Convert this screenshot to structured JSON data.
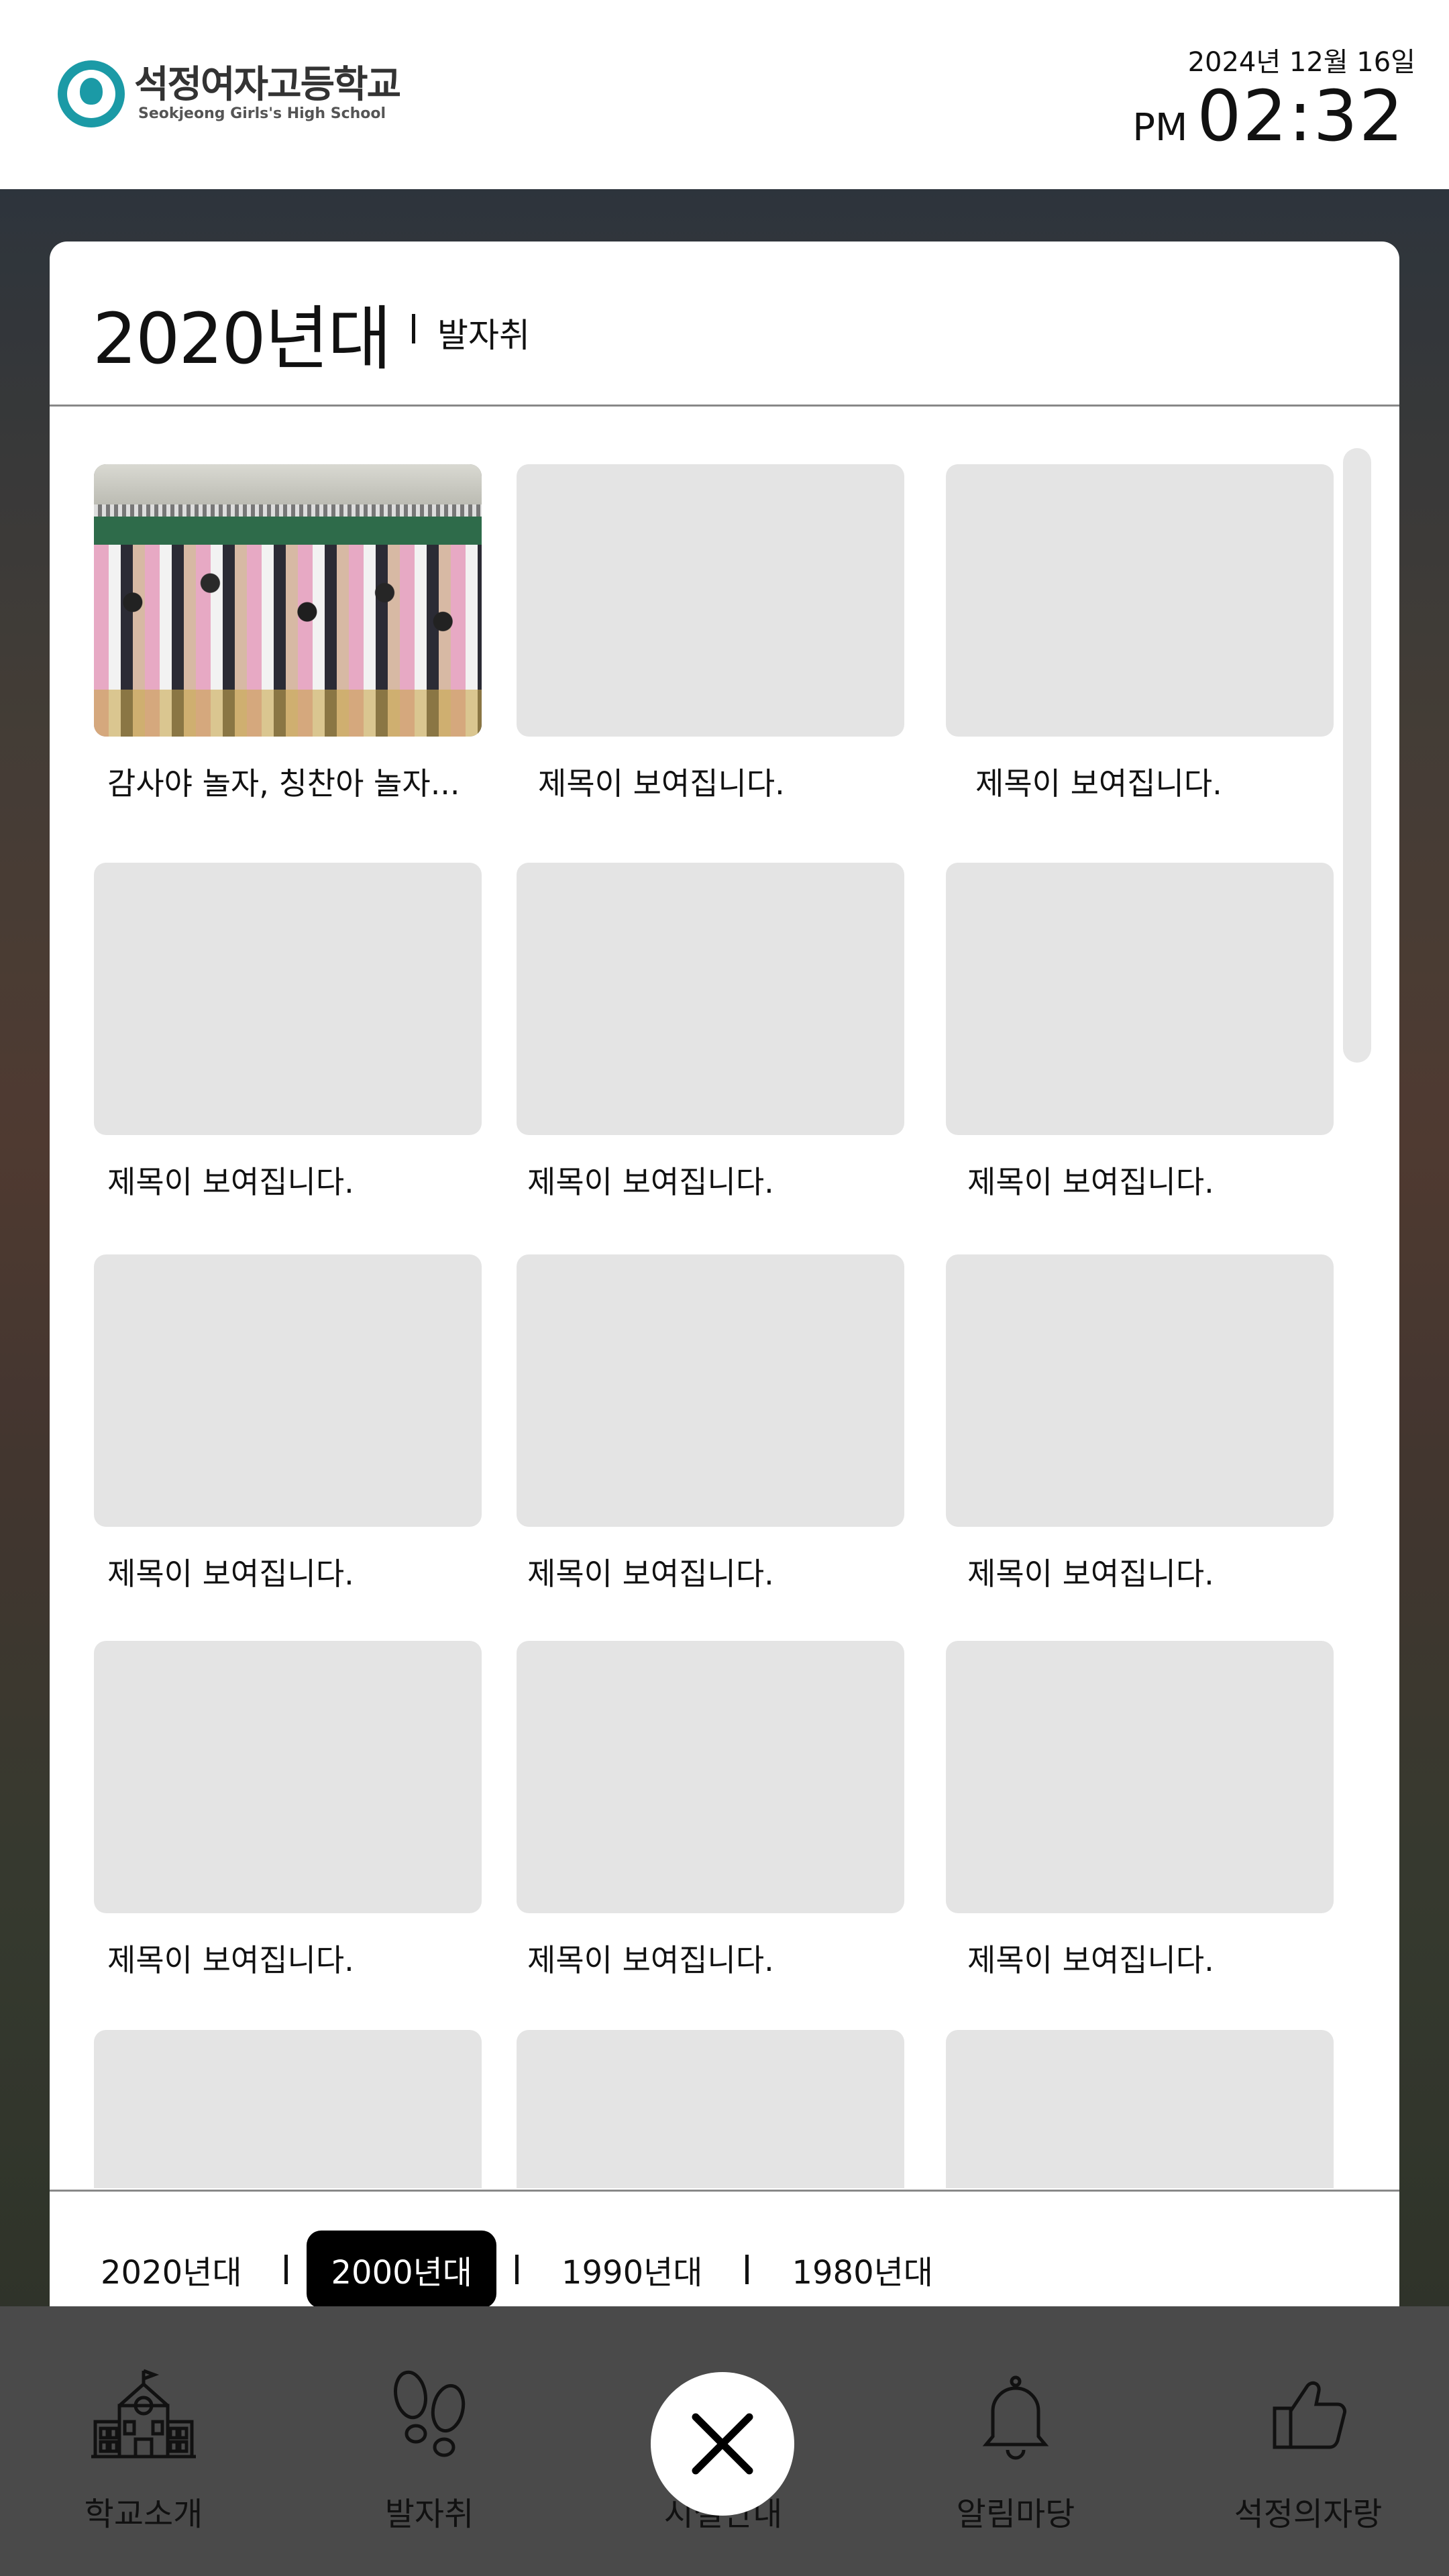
{
  "header": {
    "logo_name": "석정여자고등학교",
    "logo_sub": "Seokjeong Girls's High School",
    "date": "2024년 12월 16일",
    "ampm": "PM",
    "time": "02:32"
  },
  "modal": {
    "title": "2020년대",
    "subtitle": "발자취",
    "items": [
      {
        "caption": "감사야 놀자, 칭찬아 놀자..."
      },
      {
        "caption": "제목이 보여집니다."
      },
      {
        "caption": "제목이 보여집니다."
      },
      {
        "caption": "제목이 보여집니다."
      },
      {
        "caption": "제목이 보여집니다."
      },
      {
        "caption": "제목이 보여집니다."
      },
      {
        "caption": "제목이 보여집니다."
      },
      {
        "caption": "제목이 보여집니다."
      },
      {
        "caption": "제목이 보여집니다."
      },
      {
        "caption": "제목이 보여집니다."
      },
      {
        "caption": "제목이 보여집니다."
      },
      {
        "caption": "제목이 보여집니다."
      }
    ],
    "tabs": [
      "2020년대",
      "2000년대",
      "1990년대",
      "1980년대"
    ],
    "active_tab": "2000년대"
  },
  "nav": {
    "items": [
      {
        "label": "학교소개",
        "icon": "school-building-icon"
      },
      {
        "label": "발자취",
        "icon": "footprints-icon"
      },
      {
        "label": "시설안내",
        "icon": "close-icon"
      },
      {
        "label": "알림마당",
        "icon": "bell-icon"
      },
      {
        "label": "석정의자랑",
        "icon": "thumbs-up-icon"
      }
    ]
  },
  "colors": {
    "brand_teal": "#1b9aa6",
    "placeholder": "#e4e4e4",
    "active_tab_bg": "#000000",
    "nav_bg": "#4a4a4a"
  }
}
